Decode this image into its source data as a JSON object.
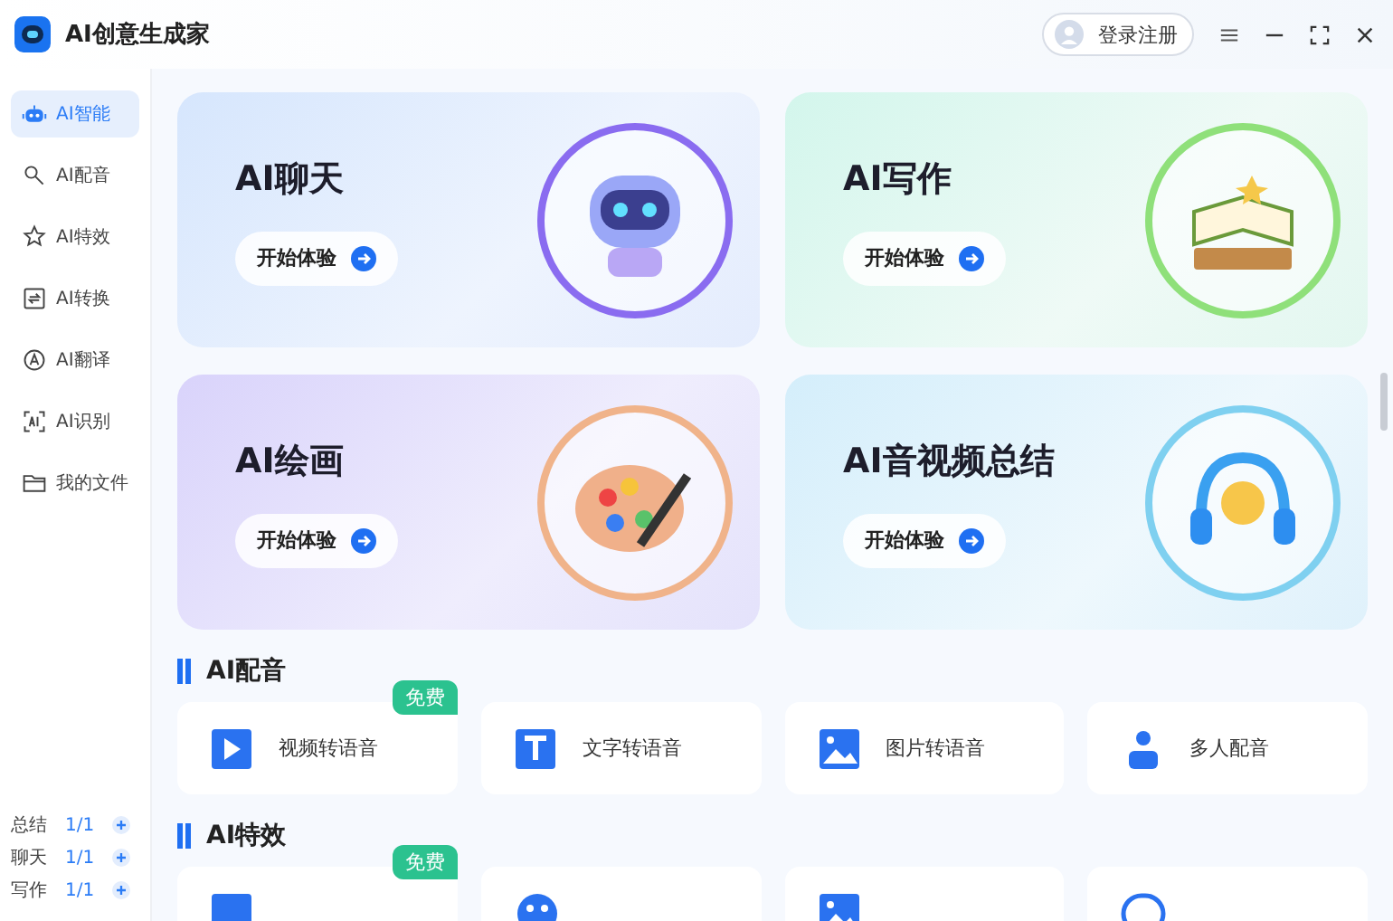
{
  "app": {
    "title": "AI创意生成家"
  },
  "header": {
    "login_label": "登录注册"
  },
  "sidebar": {
    "items": [
      {
        "label": "AI智能",
        "kind": "robot",
        "selected": true
      },
      {
        "label": "AI配音",
        "kind": "mic",
        "selected": false
      },
      {
        "label": "AI特效",
        "kind": "star",
        "selected": false
      },
      {
        "label": "AI转换",
        "kind": "convert",
        "selected": false
      },
      {
        "label": "AI翻译",
        "kind": "translate",
        "selected": false
      },
      {
        "label": "AI识别",
        "kind": "scan",
        "selected": false
      },
      {
        "label": "我的文件",
        "kind": "folder",
        "selected": false
      }
    ],
    "quotas": [
      {
        "label": "总结",
        "count": "1/1"
      },
      {
        "label": "聊天",
        "count": "1/1"
      },
      {
        "label": "写作",
        "count": "1/1"
      }
    ]
  },
  "feature_cards": [
    {
      "title": "AI聊天",
      "button": "开始体验",
      "kind": "chat"
    },
    {
      "title": "AI写作",
      "button": "开始体验",
      "kind": "writing"
    },
    {
      "title": "AI绘画",
      "button": "开始体验",
      "kind": "painting"
    },
    {
      "title": "AI音视频总结",
      "button": "开始体验",
      "kind": "summary"
    }
  ],
  "sections": [
    {
      "title": "AI配音",
      "tools": [
        {
          "label": "视频转语音",
          "kind": "video",
          "badge": "免费"
        },
        {
          "label": "文字转语音",
          "kind": "text"
        },
        {
          "label": "图片转语音",
          "kind": "image"
        },
        {
          "label": "多人配音",
          "kind": "people"
        }
      ]
    },
    {
      "title": "AI特效",
      "tools": [
        {
          "kind": "photo",
          "badge": "免费"
        },
        {
          "kind": "face"
        },
        {
          "kind": "image"
        },
        {
          "kind": "frame"
        }
      ]
    }
  ]
}
